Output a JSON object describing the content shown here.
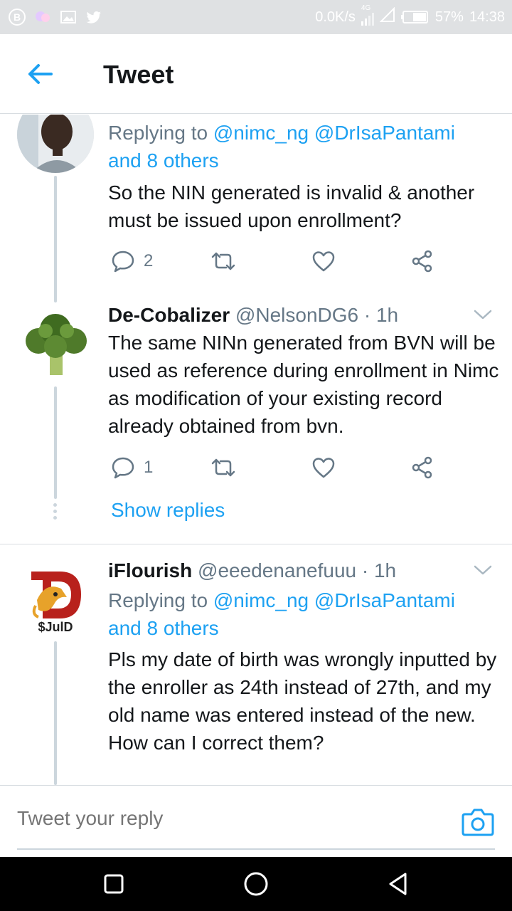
{
  "status_bar": {
    "net_speed": "0.0K/s",
    "network": "4G",
    "battery": "57%",
    "time": "14:38"
  },
  "header": {
    "title": "Tweet",
    "back_icon": "arrow-left-icon"
  },
  "tweets": [
    {
      "reply_prefix": "Replying to",
      "mentions": "@nimc_ng @DrIsaPantami",
      "others": "and 8 others",
      "text": "So the NIN generated is invalid & another must be issued upon enrollment?",
      "reply_count": "2"
    },
    {
      "name": "De-Cobalizer",
      "handle": "@NelsonDG6 · 1h",
      "text": "The same NINn generated from BVN will be used as reference during enrollment in Nimc as modification of your existing record already obtained from bvn.",
      "reply_count": "1",
      "show_replies": "Show replies"
    },
    {
      "name": "iFlourish",
      "handle": "@eeedenanefuuu · 1h",
      "reply_prefix": "Replying to",
      "mentions": "@nimc_ng @DrIsaPantami",
      "others": "and 8 others",
      "text": "Pls my date of birth was wrongly inputted by the enroller as 24th instead of 27th, and my old name was entered instead of the new. How can I correct them?",
      "avatar_label": "$JulD"
    }
  ],
  "composer": {
    "placeholder": "Tweet your reply"
  },
  "colors": {
    "accent": "#1da1f2",
    "muted": "#657786",
    "text": "#14171a"
  }
}
